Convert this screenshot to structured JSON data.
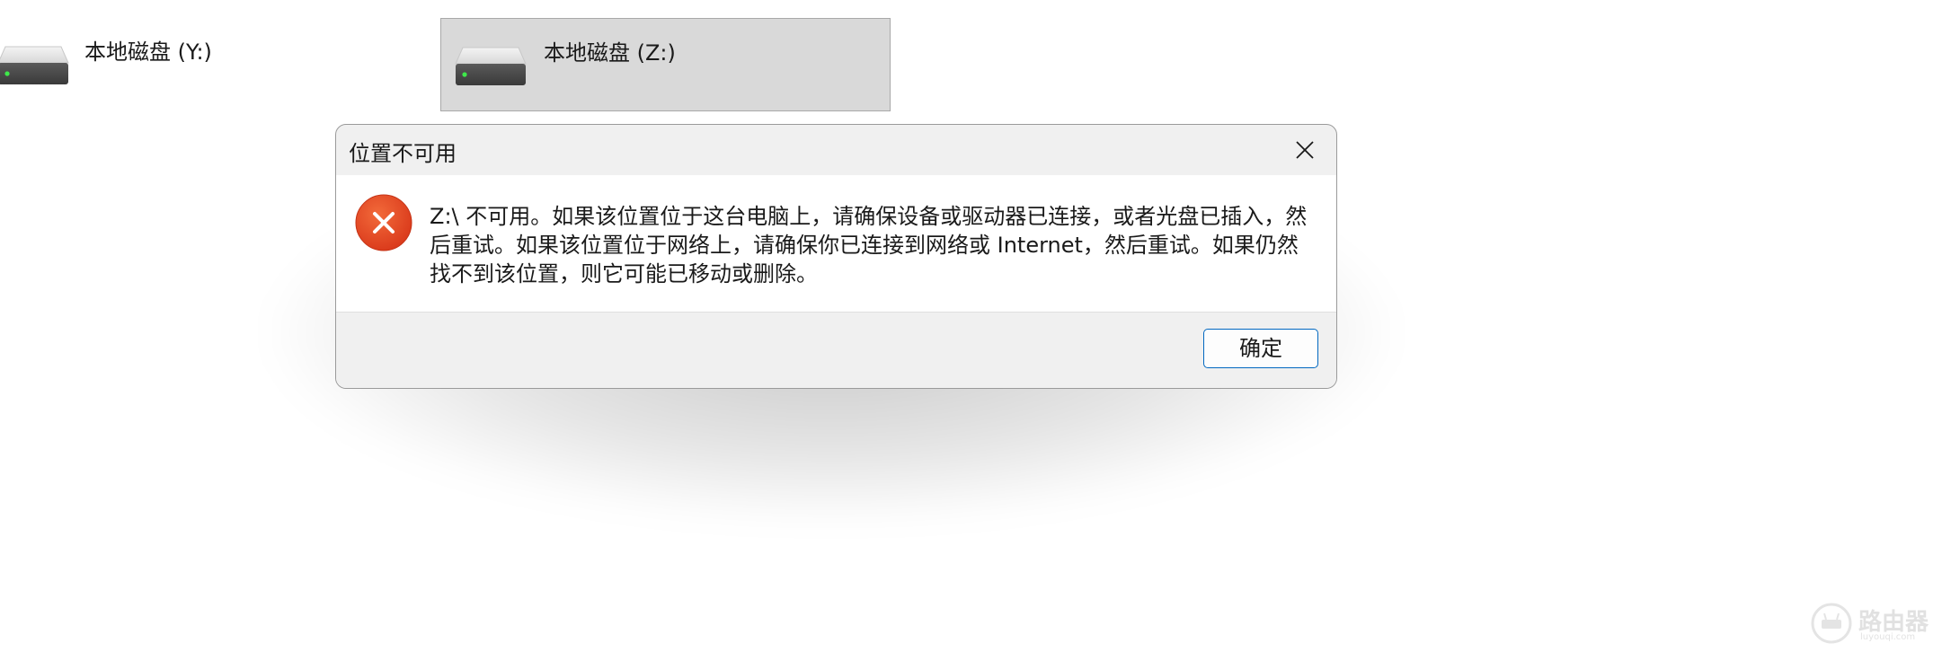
{
  "explorer": {
    "drives": [
      {
        "label": "本地磁盘 (Y:)",
        "selected": false
      },
      {
        "label": "本地磁盘 (Z:)",
        "selected": true
      }
    ]
  },
  "dialog": {
    "title": "位置不可用",
    "icon": "error-icon",
    "message": "Z:\\ 不可用。如果该位置位于这台电脑上，请确保设备或驱动器已连接，或者光盘已插入，然后重试。如果该位置位于网络上，请确保你已连接到网络或 Internet，然后重试。如果仍然找不到该位置，则它可能已移动或删除。",
    "ok_label": "确定",
    "close_icon": "close-icon"
  },
  "watermark": {
    "text": "路由器",
    "sub": "luyouqi.com"
  },
  "colors": {
    "error_red": "#e2431e",
    "accent_blue": "#0067c0",
    "selected_tile": "#d9d9d9"
  }
}
